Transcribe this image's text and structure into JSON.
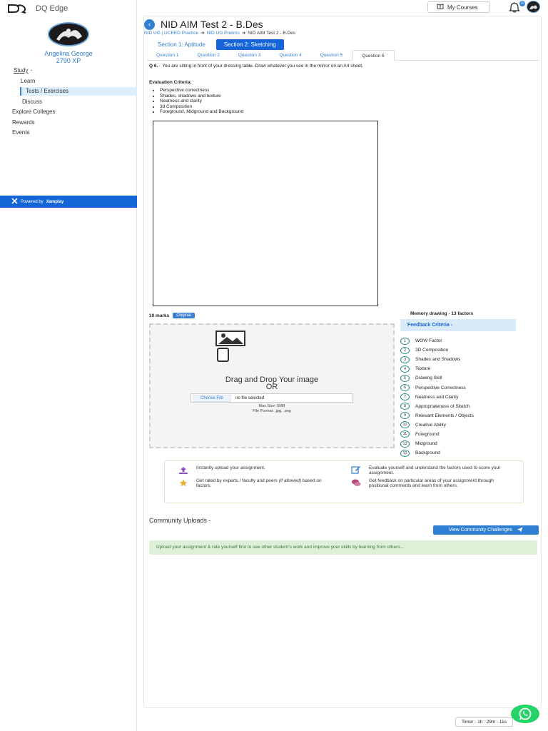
{
  "app": {
    "name": "DQ Edge"
  },
  "user": {
    "name": "Angelina George",
    "xp": "2790 XP"
  },
  "sidebar": {
    "items": [
      {
        "label": "Study"
      },
      {
        "label": "Learn"
      },
      {
        "label": "Tests / Exercises"
      },
      {
        "label": "Discuss"
      },
      {
        "label": "Explore Colleges"
      },
      {
        "label": "Rewards"
      },
      {
        "label": "Events"
      }
    ],
    "study_caret": "-",
    "powered_by": "Powered by",
    "powered_brand": "Xamplay"
  },
  "topbar": {
    "my_courses": "My Courses",
    "notification_count": "19"
  },
  "page": {
    "title": "NID AIM Test 2 - B.Des",
    "breadcrumb": [
      "NID UG | UCEED Practice",
      "NID UG Prelims",
      "NID AIM Test 2 - B.Des"
    ]
  },
  "sections": [
    "Section 1: Aptitude",
    "Section 2: Sketching"
  ],
  "questions": [
    "Question 1",
    "Question 2",
    "Question 3",
    "Question 4",
    "Question 5",
    "Question 6"
  ],
  "question": {
    "number": "Q 6.",
    "text": "You are sitting in front of your dressing table. Draw whatever you see in the mirror on an A4 sheet.",
    "eval_title": "Evaluation Criteria:",
    "criteria": [
      "Perspective correctness",
      "Shades, shadows and texture",
      "Neatness and clarity",
      "3d Composition",
      "Foreground, Midground and Background"
    ]
  },
  "marks": {
    "label": "10 marks",
    "badge": "Original"
  },
  "upload": {
    "title_line1": "Drag and Drop Your image",
    "title_line2": "OR",
    "choose_label": "Choose File",
    "no_file": "no file selected",
    "max_size": "Max Size: 5MB",
    "formats": "File Format: .jpg, .png"
  },
  "feedback": {
    "memory_title": "Memory drawing - 13 factors",
    "criteria_label": "Feedback Criteria -",
    "factors": [
      "WOW Factor",
      "3D Composition",
      "Shades and Shadows",
      "Texture",
      "Drawing Skill",
      "Perspective Correctness",
      "Neatness and Clarity",
      "Appropriateness of Sketch",
      "Relevant Elements / Objects",
      "Creative Ability",
      "Foreground",
      "Midground",
      "Background"
    ]
  },
  "info": {
    "upload": "Instantly upload your assignment.",
    "rated_pre": "Get rated by experts / faculty and peers",
    "rated_italic": "(if allowed)",
    "rated_post": "based on factors.",
    "evaluate": "Evaluate yourself and understand the factors used to score your assignment.",
    "feedback": "Get feedback on particular areas of your assignment through positional comments and learn from others."
  },
  "community": {
    "title": "Community Uploads -",
    "button": "View Community Challenges",
    "note": "Upload your assignment & rate yourself first to see other student's work and improve your skills by learning from others..."
  },
  "timer": "Timer - 1h : 29m : 11s"
}
